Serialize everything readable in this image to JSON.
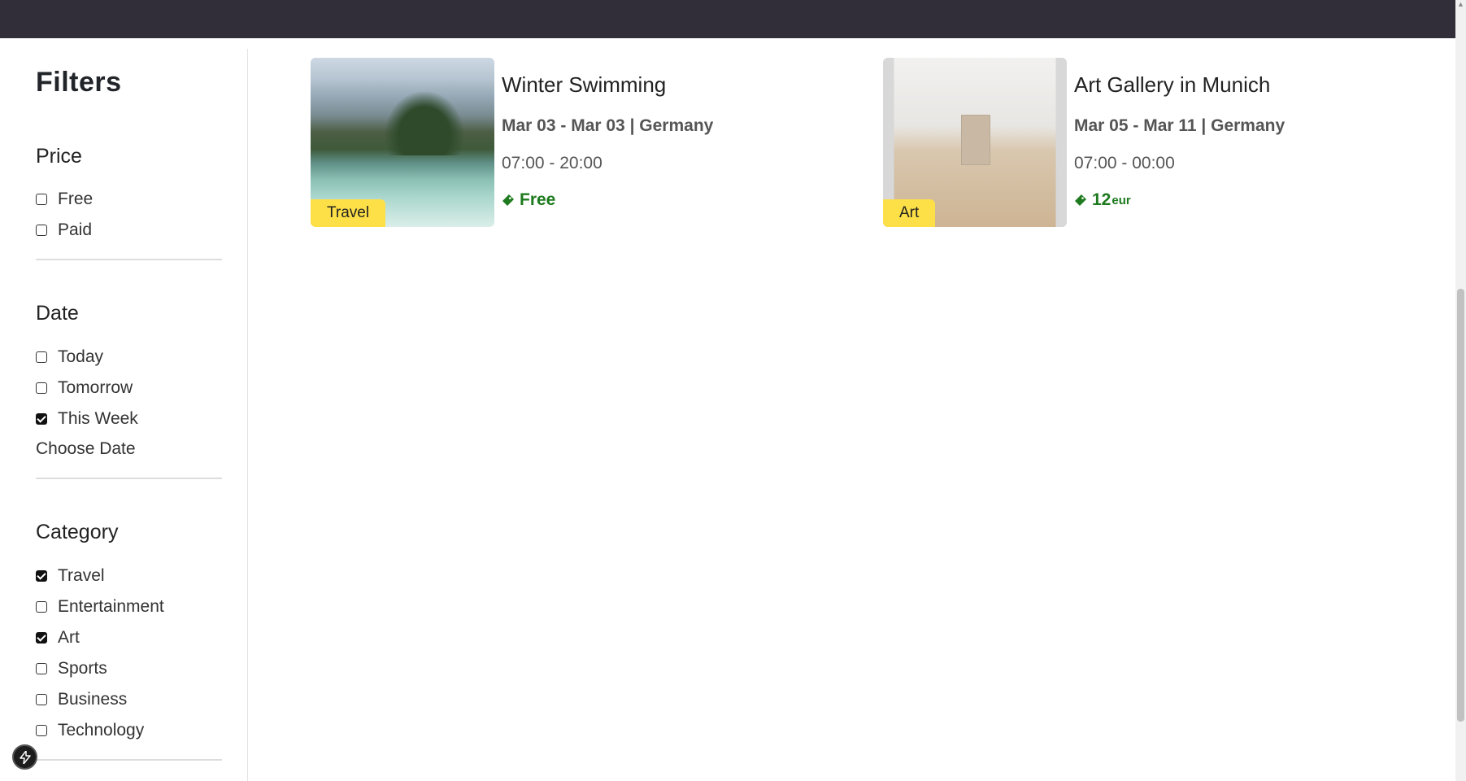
{
  "sidebar": {
    "title": "Filters",
    "price": {
      "title": "Price",
      "options": [
        {
          "label": "Free",
          "checked": false
        },
        {
          "label": "Paid",
          "checked": false
        }
      ]
    },
    "date": {
      "title": "Date",
      "options": [
        {
          "label": "Today",
          "checked": false
        },
        {
          "label": "Tomorrow",
          "checked": false
        },
        {
          "label": "This Week",
          "checked": true
        }
      ],
      "choose_date": "Choose Date"
    },
    "category": {
      "title": "Category",
      "options": [
        {
          "label": "Travel",
          "checked": true
        },
        {
          "label": "Entertainment",
          "checked": false
        },
        {
          "label": "Art",
          "checked": true
        },
        {
          "label": "Sports",
          "checked": false
        },
        {
          "label": "Business",
          "checked": false
        },
        {
          "label": "Technology",
          "checked": false
        }
      ]
    }
  },
  "events": [
    {
      "title": "Winter Swimming",
      "dates": "Mar 03 - Mar 03 | Germany",
      "time": "07:00 - 20:00",
      "price": "Free",
      "currency": "",
      "tag": "Travel",
      "image_icon": "lake-mountains-image"
    },
    {
      "title": "Art Gallery in Munich",
      "dates": "Mar 05 - Mar 11 | Germany",
      "time": "07:00 - 00:00",
      "price": "12",
      "currency": "eur",
      "tag": "Art",
      "image_icon": "gallery-hallway-image"
    }
  ],
  "colors": {
    "topbar": "#312d39",
    "tag_bg": "#fde047",
    "price_green": "#1e7a1e"
  },
  "icons": {
    "price": "ticket-icon",
    "floating_button": "bolt-icon"
  }
}
